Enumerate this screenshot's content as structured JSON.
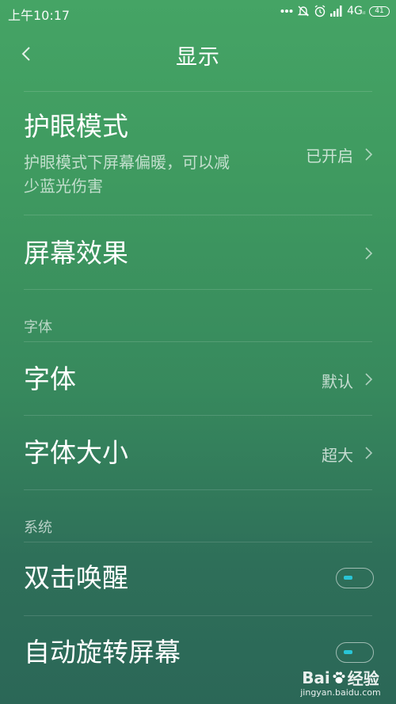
{
  "status_bar": {
    "time": "上午10:17",
    "network": "4G",
    "network_suffix": "ᵢₗ",
    "battery": "41",
    "icons": [
      "more-dots-icon",
      "mute-icon",
      "alarm-icon",
      "signal-icon",
      "battery-icon"
    ]
  },
  "header": {
    "title": "显示",
    "back_icon": "chevron-left-icon"
  },
  "items": {
    "eye_care": {
      "title": "护眼模式",
      "subtitle_line1": "护眼模式下屏幕偏暖，可以减",
      "subtitle_line2": "少蓝光伤害",
      "value": "已开启"
    },
    "screen_effect": {
      "title": "屏幕效果"
    },
    "font": {
      "title": "字体",
      "value": "默认"
    },
    "font_size": {
      "title": "字体大小",
      "value": "超大"
    },
    "double_tap_wake": {
      "title": "双击唤醒",
      "enabled": false
    },
    "auto_rotate": {
      "title": "自动旋转屏幕",
      "enabled": false
    }
  },
  "sections": {
    "font_header": "字体",
    "system_header": "系统"
  },
  "watermark": {
    "logo_text": "Bai",
    "logo_text2": "经验",
    "url": "jingyan.baidu.com"
  },
  "colors": {
    "background_top": "#45a465",
    "background_bottom": "#2b6757",
    "toggle_accent": "#29c5d6"
  }
}
